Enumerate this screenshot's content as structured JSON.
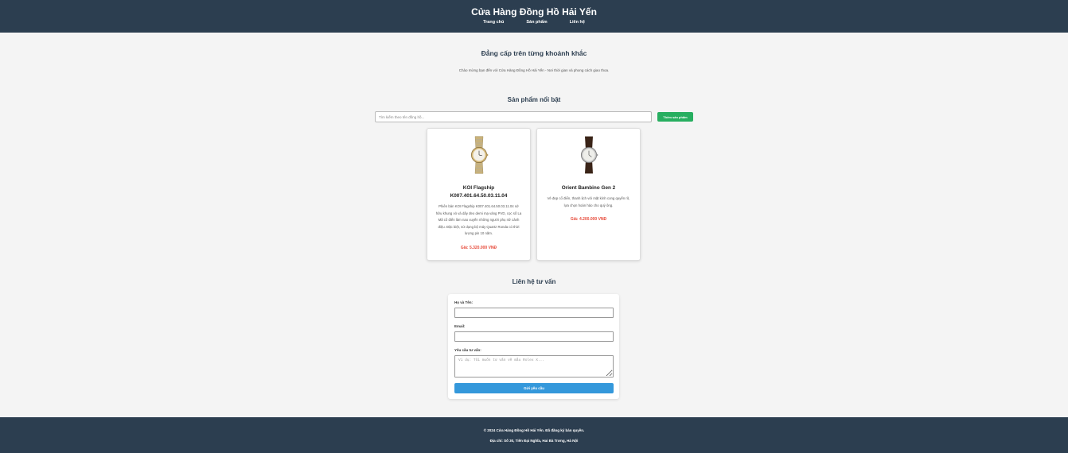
{
  "header": {
    "title": "Cửa Hàng Đồng Hồ Hải Yến",
    "nav": [
      "Trang chủ",
      "Sản phẩm",
      "Liên hệ"
    ]
  },
  "hero": {
    "heading": "Đẳng cấp trên từng khoảnh khắc",
    "subtext": "Chào mừng bạn đến với Cửa Hàng Đồng Hồ Hải Yến - Nơi thời gian và phong cách giao thoa."
  },
  "products": {
    "title": "Sản phẩm nổi bật",
    "search_placeholder": "Tìm kiếm theo tên đồng hồ...",
    "add_button": "Thêm sản phẩm",
    "items": [
      {
        "name": "KOI Flagship K007.401.64.50.03.11.04",
        "description": "Phiên bản KOI Flagship K007.401.64.50.03.11.04 sở hữu khung vỏ và dây đeo demi mạ vàng PVD, cọc số La Mã cổ điển làm nao xuyến những người phụ nữ cảnh điệu. Đặc biệt, sử dụng bộ máy Quartz Ronda có thời lượng pin 10 năm.",
        "price_label": "Giá:",
        "price": "5.320.000 VNĐ"
      },
      {
        "name": "Orient Bambino Gen 2",
        "description": "Vẻ đẹp cổ điển, thanh lịch với mặt kính cong quyến rũ, lựa chọn hoàn hảo cho quý ông.",
        "price_label": "Giá:",
        "price": "4.200.000 VNĐ"
      }
    ]
  },
  "contact": {
    "title": "Liên hệ tư vấn",
    "name_label": "Họ và Tên:",
    "email_label": "Email:",
    "request_label": "Yêu cầu tư vấn:",
    "request_placeholder": "Ví dụ: Tôi muốn tư vấn về mẫu Rolex X...",
    "submit": "Gửi yêu cầu"
  },
  "footer": {
    "copyright": "© 2024 Cửa Hàng Đồng Hồ Hải Yến. Đã đăng ký bản quyền.",
    "address": "Địa chỉ: Số 30, Tiên Đại Nghĩa, Hai Bà Trưng, Hà Nội"
  },
  "colors": {
    "header_bg": "#2c3e50",
    "add_button": "#27ae60",
    "submit_button": "#3498db",
    "price": "#e74c3c"
  }
}
